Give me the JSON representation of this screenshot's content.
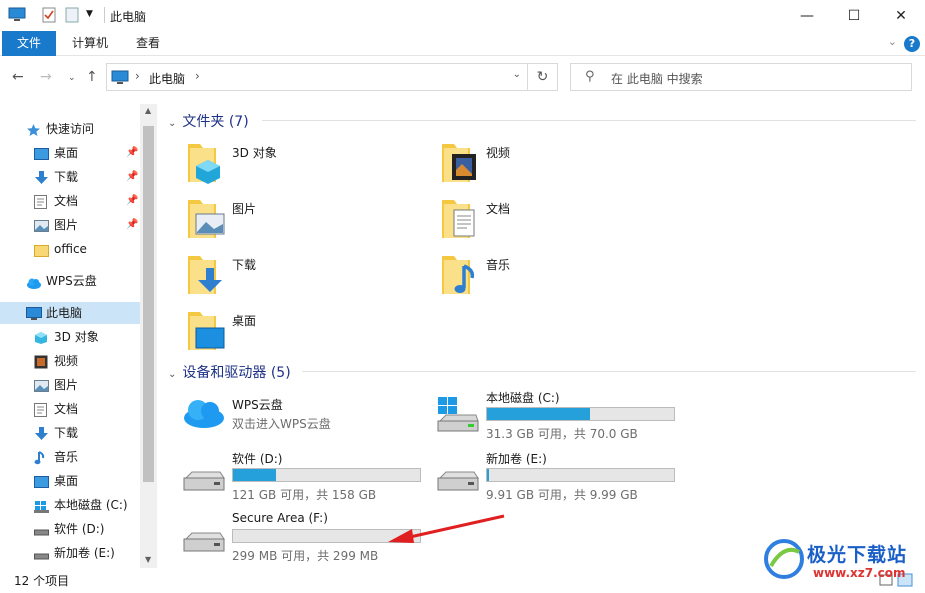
{
  "window": {
    "title": "此电脑",
    "minimize": "—",
    "maximize": "☐",
    "close": "✕"
  },
  "ribbon": {
    "tabs": [
      "文件",
      "计算机",
      "查看"
    ],
    "help": "?"
  },
  "address": {
    "crumb": "此电脑",
    "search_placeholder": "在 此电脑 中搜索"
  },
  "sidebar": {
    "quick_access": "快速访问",
    "quick_items": [
      "桌面",
      "下载",
      "文档",
      "图片",
      "office"
    ],
    "wps": "WPS云盘",
    "this_pc": "此电脑",
    "pc_items": [
      "3D 对象",
      "视频",
      "图片",
      "文档",
      "下载",
      "音乐",
      "桌面",
      "本地磁盘 (C:)",
      "软件 (D:)",
      "新加卷 (E:)"
    ]
  },
  "folders": {
    "header": "文件夹 (7)",
    "items": [
      "3D 对象",
      "视频",
      "图片",
      "文档",
      "下载",
      "音乐",
      "桌面"
    ]
  },
  "devices": {
    "header": "设备和驱动器 (5)",
    "wps": {
      "name": "WPS云盘",
      "sub": "双击进入WPS云盘"
    },
    "drives": [
      {
        "name": "本地磁盘 (C:)",
        "size": "31.3 GB 可用，共 70.0 GB",
        "used_fraction": 0.55
      },
      {
        "name": "软件 (D:)",
        "size": "121 GB 可用，共 158 GB",
        "used_fraction": 0.23
      },
      {
        "name": "新加卷 (E:)",
        "size": "9.91 GB 可用，共 9.99 GB",
        "used_fraction": 0.01
      },
      {
        "name": "Secure Area (F:)",
        "size": "299 MB 可用，共 299 MB",
        "used_fraction": 0.0
      }
    ]
  },
  "status": {
    "count": "12 个项目"
  },
  "watermark": {
    "text": "极光下载站",
    "url": "www.xz7.com"
  },
  "colors": {
    "accent": "#1979ca",
    "bar_fill": "#26a0da",
    "header_blue": "#1e3287",
    "arrow_red": "#e02020"
  }
}
